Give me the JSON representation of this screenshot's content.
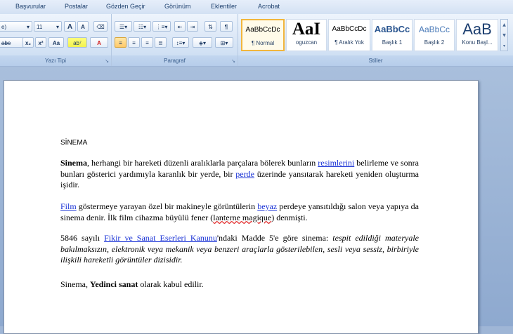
{
  "menu": [
    "Başvurular",
    "Postalar",
    "Gözden Geçir",
    "Görünüm",
    "Eklentiler",
    "Acrobat"
  ],
  "font_group": {
    "label": "Yazı Tipi",
    "font_name": "e)",
    "font_size": "11",
    "grow_label": "A",
    "shrink_label": "A",
    "strike_label": "abe",
    "subscript_label": "x₂",
    "superscript_label": "x²",
    "case_label": "Aa",
    "highlight_label": "ab⁷",
    "fontcolor_label": "A"
  },
  "paragraph_group": {
    "label": "Paragraf"
  },
  "styles_group": {
    "label": "Stiller",
    "styles": [
      {
        "sample": "AaBbCcDc",
        "name": "¶ Normal"
      },
      {
        "sample": "AaI",
        "name": "oguzcan"
      },
      {
        "sample": "AaBbCcDc",
        "name": "¶ Aralık Yok"
      },
      {
        "sample": "AaBbCc",
        "name": "Başlık 1"
      },
      {
        "sample": "AaBbCc",
        "name": "Başlık 2"
      },
      {
        "sample": "AaB",
        "name": "Konu Başl..."
      }
    ]
  },
  "document": {
    "heading": "SİNEMA",
    "p1": {
      "bold": "Sinema",
      "text1": ", herhangi bir hareketi düzenli aralıklarla parçalara bölerek bunların ",
      "link1": "resimlerini",
      "text2": " belirleme ve sonra bunları gösterici yardımıyla karanlık bir yerde, bir ",
      "link2": "perde",
      "text3": " üzerinde yansıtarak hareketi yeniden oluşturma işidir."
    },
    "p2": {
      "link1": "Film",
      "text1": " göstermeye yarayan özel bir makineyle görüntülerin ",
      "link2": "beyaz",
      "text2": " perdeye yansıtıldığı salon veya yapıya da sinema denir. İlk film cihazma büyülü fener (",
      "spell": "lanterne magique",
      "text3": ") denmişti."
    },
    "p3": {
      "text1": "5846 sayılı ",
      "link1": "Fikir ve Sanat Eserleri Kanunu",
      "text2": "'ndaki Madde 5'e göre sinema: ",
      "italic": "tespit edildiği materyale bakılmaksızın, elektronik veya mekanik veya benzeri araçlarla gösterilebilen, sesli veya sessiz, birbiriyle ilişkili hareketli görüntüler dizisidir."
    },
    "p4": {
      "text1": "Sinema, ",
      "bold": "Yedinci sanat",
      "text2": " olarak kabul edilir."
    }
  }
}
